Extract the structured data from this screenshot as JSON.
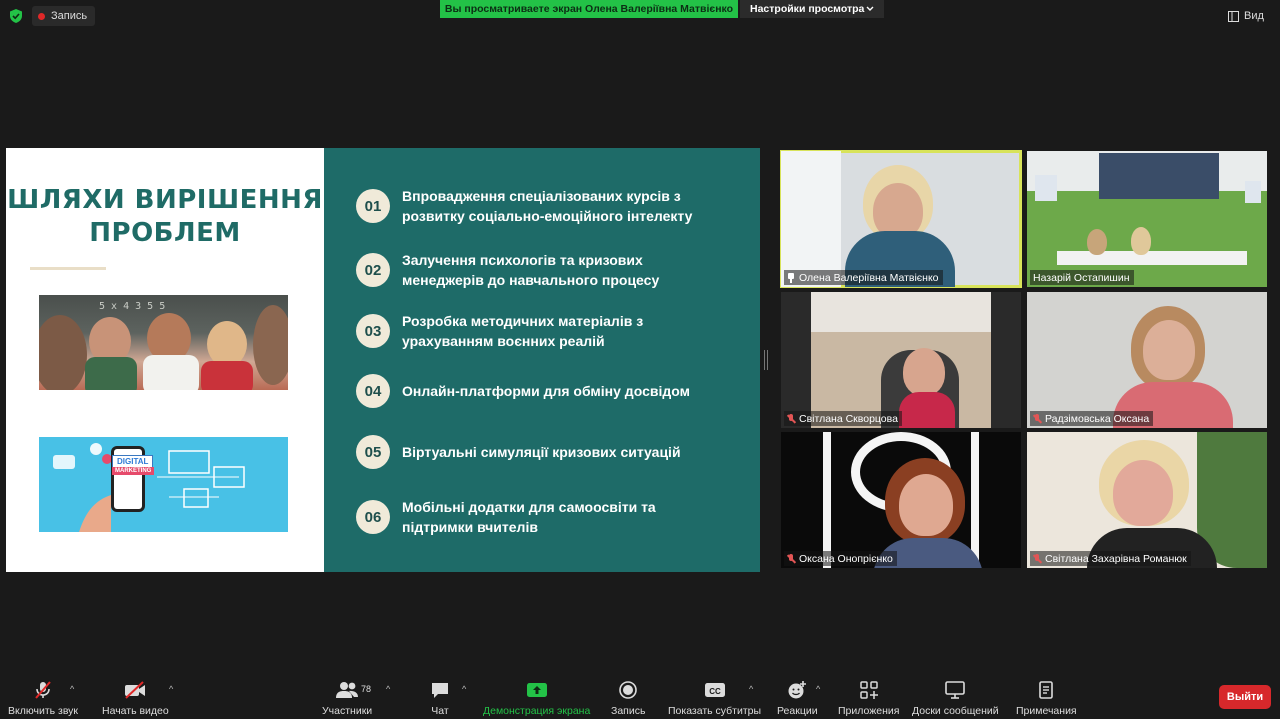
{
  "topbar": {
    "recording_label": "Запись",
    "share_banner": "Вы просматриваете экран Олена Валеріївна Матвієнко",
    "view_settings_label": "Настройки просмотра",
    "view_label": "Вид",
    "colors": {
      "banner": "#23c247",
      "record_dot": "#e02828"
    }
  },
  "slide": {
    "title_line1": "ШЛЯХИ ВИРІШЕННЯ",
    "title_line2": "ПРОБЛЕМ",
    "image_chalk": "5 x 4    3 5 5",
    "digital_badge_line1": "DIGITAL",
    "digital_badge_line2": "MARKETING",
    "items": [
      {
        "num": "01",
        "text": "Впровадження спеціалізованих курсів з розвитку соціально-емоційного інтелекту"
      },
      {
        "num": "02",
        "text": "Залучення психологів та кризових менеджерів до навчального процесу"
      },
      {
        "num": "03",
        "text": "Розробка методичних матеріалів з урахуванням воєнних реалій"
      },
      {
        "num": "04",
        "text": "Онлайн-платформи для обміну досвідом"
      },
      {
        "num": "05",
        "text": "Віртуальні симуляції кризових ситуацій"
      },
      {
        "num": "06",
        "text": "Мобільні додатки для самоосвіти та підтримки вчителів"
      }
    ],
    "colors": {
      "teal": "#1e6b68",
      "title": "#1f6b66",
      "badge": "#f0ead9"
    }
  },
  "participants": [
    {
      "name": "Олена Валеріївна Матвієнко",
      "status": "pinned",
      "active": true
    },
    {
      "name": "Назарій Остапишин",
      "status": "none",
      "active": false
    },
    {
      "name": "Світлана Скворцова",
      "status": "muted",
      "active": false
    },
    {
      "name": "Радзімовська Оксана",
      "status": "muted",
      "active": false
    },
    {
      "name": "Оксана Онопрієнко",
      "status": "muted",
      "active": false
    },
    {
      "name": "Світлана Захарівна Романюк",
      "status": "muted",
      "active": false
    }
  ],
  "toolbar": {
    "mute": "Включить звук",
    "video": "Начать видео",
    "participants": "Участники",
    "participants_count": "78",
    "chat": "Чат",
    "share": "Демонстрация экрана",
    "record": "Запись",
    "captions": "Показать субтитры",
    "captions_icon": "CC",
    "reactions": "Реакции",
    "apps": "Приложения",
    "whiteboards": "Доски сообщений",
    "notes": "Примечания",
    "end": "Выйти"
  }
}
